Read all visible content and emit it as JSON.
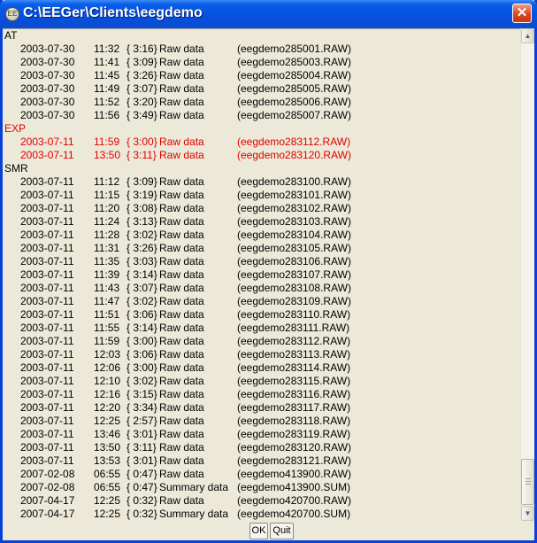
{
  "window": {
    "title": "C:\\EEGer\\Clients\\eegdemo"
  },
  "colors": {
    "titlebar": "#0550DC",
    "highlight_group": "#E00000",
    "window_bg": "#ECE9D8"
  },
  "icons": {
    "app": "eeger-app-icon",
    "close": "close-icon"
  },
  "groups": [
    {
      "name": "AT",
      "highlight": false,
      "entries": [
        {
          "date": "2003-07-30",
          "time": "11:32",
          "duration": "{ 3:16}",
          "type": "Raw data",
          "file": "(eegdemo285001.RAW)"
        },
        {
          "date": "2003-07-30",
          "time": "11:41",
          "duration": "{ 3:09}",
          "type": "Raw data",
          "file": "(eegdemo285003.RAW)"
        },
        {
          "date": "2003-07-30",
          "time": "11:45",
          "duration": "{ 3:26}",
          "type": "Raw data",
          "file": "(eegdemo285004.RAW)"
        },
        {
          "date": "2003-07-30",
          "time": "11:49",
          "duration": "{ 3:07}",
          "type": "Raw data",
          "file": "(eegdemo285005.RAW)"
        },
        {
          "date": "2003-07-30",
          "time": "11:52",
          "duration": "{ 3:20}",
          "type": "Raw data",
          "file": "(eegdemo285006.RAW)"
        },
        {
          "date": "2003-07-30",
          "time": "11:56",
          "duration": "{ 3:49}",
          "type": "Raw data",
          "file": "(eegdemo285007.RAW)"
        }
      ]
    },
    {
      "name": "EXP",
      "highlight": true,
      "entries": [
        {
          "date": "2003-07-11",
          "time": "11:59",
          "duration": "{ 3:00}",
          "type": "Raw data",
          "file": "(eegdemo283112.RAW)"
        },
        {
          "date": "2003-07-11",
          "time": "13:50",
          "duration": "{ 3:11}",
          "type": "Raw data",
          "file": "(eegdemo283120.RAW)"
        }
      ]
    },
    {
      "name": "SMR",
      "highlight": false,
      "entries": [
        {
          "date": "2003-07-11",
          "time": "11:12",
          "duration": "{ 3:09}",
          "type": "Raw data",
          "file": "(eegdemo283100.RAW)"
        },
        {
          "date": "2003-07-11",
          "time": "11:15",
          "duration": "{ 3:19}",
          "type": "Raw data",
          "file": "(eegdemo283101.RAW)"
        },
        {
          "date": "2003-07-11",
          "time": "11:20",
          "duration": "{ 3:08}",
          "type": "Raw data",
          "file": "(eegdemo283102.RAW)"
        },
        {
          "date": "2003-07-11",
          "time": "11:24",
          "duration": "{ 3:13}",
          "type": "Raw data",
          "file": "(eegdemo283103.RAW)"
        },
        {
          "date": "2003-07-11",
          "time": "11:28",
          "duration": "{ 3:02}",
          "type": "Raw data",
          "file": "(eegdemo283104.RAW)"
        },
        {
          "date": "2003-07-11",
          "time": "11:31",
          "duration": "{ 3:26}",
          "type": "Raw data",
          "file": "(eegdemo283105.RAW)"
        },
        {
          "date": "2003-07-11",
          "time": "11:35",
          "duration": "{ 3:03}",
          "type": "Raw data",
          "file": "(eegdemo283106.RAW)"
        },
        {
          "date": "2003-07-11",
          "time": "11:39",
          "duration": "{ 3:14}",
          "type": "Raw data",
          "file": "(eegdemo283107.RAW)"
        },
        {
          "date": "2003-07-11",
          "time": "11:43",
          "duration": "{ 3:07}",
          "type": "Raw data",
          "file": "(eegdemo283108.RAW)"
        },
        {
          "date": "2003-07-11",
          "time": "11:47",
          "duration": "{ 3:02}",
          "type": "Raw data",
          "file": "(eegdemo283109.RAW)"
        },
        {
          "date": "2003-07-11",
          "time": "11:51",
          "duration": "{ 3:06}",
          "type": "Raw data",
          "file": "(eegdemo283110.RAW)"
        },
        {
          "date": "2003-07-11",
          "time": "11:55",
          "duration": "{ 3:14}",
          "type": "Raw data",
          "file": "(eegdemo283111.RAW)"
        },
        {
          "date": "2003-07-11",
          "time": "11:59",
          "duration": "{ 3:00}",
          "type": "Raw data",
          "file": "(eegdemo283112.RAW)"
        },
        {
          "date": "2003-07-11",
          "time": "12:03",
          "duration": "{ 3:06}",
          "type": "Raw data",
          "file": "(eegdemo283113.RAW)"
        },
        {
          "date": "2003-07-11",
          "time": "12:06",
          "duration": "{ 3:00}",
          "type": "Raw data",
          "file": "(eegdemo283114.RAW)"
        },
        {
          "date": "2003-07-11",
          "time": "12:10",
          "duration": "{ 3:02}",
          "type": "Raw data",
          "file": "(eegdemo283115.RAW)"
        },
        {
          "date": "2003-07-11",
          "time": "12:16",
          "duration": "{ 3:15}",
          "type": "Raw data",
          "file": "(eegdemo283116.RAW)"
        },
        {
          "date": "2003-07-11",
          "time": "12:20",
          "duration": "{ 3:34}",
          "type": "Raw data",
          "file": "(eegdemo283117.RAW)"
        },
        {
          "date": "2003-07-11",
          "time": "12:25",
          "duration": "{ 2:57}",
          "type": "Raw data",
          "file": "(eegdemo283118.RAW)"
        },
        {
          "date": "2003-07-11",
          "time": "13:46",
          "duration": "{ 3:01}",
          "type": "Raw data",
          "file": "(eegdemo283119.RAW)"
        },
        {
          "date": "2003-07-11",
          "time": "13:50",
          "duration": "{ 3:11}",
          "type": "Raw data",
          "file": "(eegdemo283120.RAW)"
        },
        {
          "date": "2003-07-11",
          "time": "13:53",
          "duration": "{ 3:01}",
          "type": "Raw data",
          "file": "(eegdemo283121.RAW)"
        },
        {
          "date": "2007-02-08",
          "time": "06:55",
          "duration": "{ 0:47}",
          "type": "Raw data",
          "file": "(eegdemo413900.RAW)"
        },
        {
          "date": "2007-02-08",
          "time": "06:55",
          "duration": "{ 0:47}",
          "type": "Summary data",
          "file": "(eegdemo413900.SUM)"
        },
        {
          "date": "2007-04-17",
          "time": "12:25",
          "duration": "{ 0:32}",
          "type": "Raw data",
          "file": "(eegdemo420700.RAW)"
        },
        {
          "date": "2007-04-17",
          "time": "12:25",
          "duration": "{ 0:32}",
          "type": "Summary data",
          "file": "(eegdemo420700.SUM)"
        }
      ]
    }
  ],
  "buttons": {
    "ok": "OK",
    "quit": "Quit"
  }
}
